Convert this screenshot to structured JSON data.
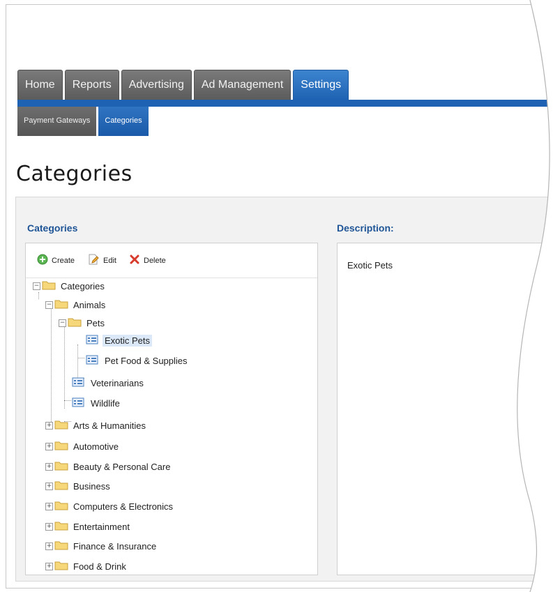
{
  "nav": {
    "main_tabs": [
      "Home",
      "Reports",
      "Advertising",
      "Ad Management",
      "Settings"
    ],
    "active_main": "Settings",
    "sub_tabs": [
      "Payment Gateways",
      "Categories"
    ],
    "active_sub": "Categories"
  },
  "page": {
    "title": "Categories"
  },
  "left_panel": {
    "label": "Categories",
    "toolbar": {
      "create": "Create",
      "edit": "Edit",
      "delete": "Delete"
    },
    "tree": {
      "root": "Categories",
      "animals": "Animals",
      "pets": "Pets",
      "exotic_pets": "Exotic Pets",
      "pet_food": "Pet Food & Supplies",
      "veterinarians": "Veterinarians",
      "wildlife": "Wildlife",
      "arts": "Arts & Humanities",
      "automotive": "Automotive",
      "beauty": "Beauty & Personal Care",
      "business": "Business",
      "computers": "Computers & Electronics",
      "entertainment": "Entertainment",
      "finance": "Finance & Insurance",
      "food": "Food & Drink"
    },
    "selected": "Exotic Pets",
    "expand_glyph": "+",
    "collapse_glyph": "−"
  },
  "right_panel": {
    "label": "Description:",
    "value": "Exotic Pets"
  },
  "colors": {
    "accent": "#1e63b3",
    "tab_gray": "#666666",
    "label_blue": "#1f5596",
    "selection": "#dbe8f7"
  },
  "icons": {
    "create": "green-plus-circle-icon",
    "edit": "pencil-document-icon",
    "delete": "red-x-icon",
    "folder": "folder-icon",
    "item": "list-item-icon"
  }
}
